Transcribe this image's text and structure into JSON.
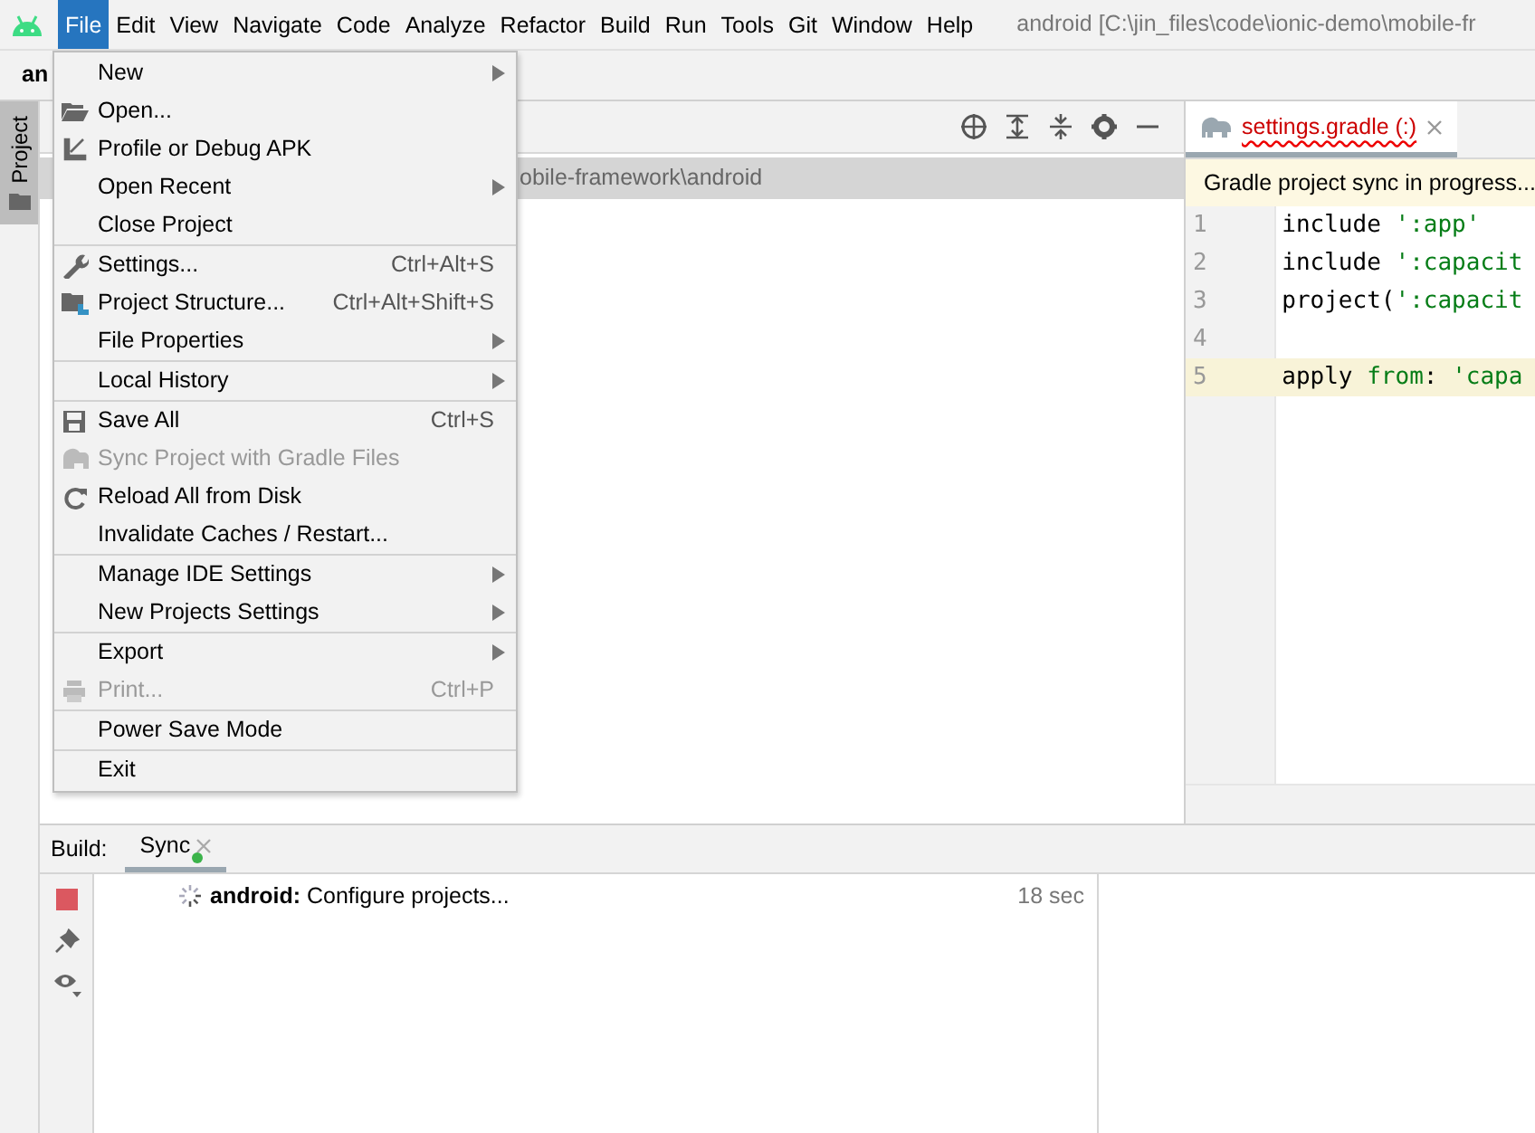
{
  "menu_bar": {
    "items": [
      {
        "label": "File",
        "selected": true
      },
      {
        "label": "Edit",
        "selected": false
      },
      {
        "label": "View",
        "selected": false
      },
      {
        "label": "Navigate",
        "selected": false
      },
      {
        "label": "Code",
        "selected": false
      },
      {
        "label": "Analyze",
        "selected": false
      },
      {
        "label": "Refactor",
        "selected": false
      },
      {
        "label": "Build",
        "selected": false
      },
      {
        "label": "Run",
        "selected": false
      },
      {
        "label": "Tools",
        "selected": false
      },
      {
        "label": "Git",
        "selected": false
      },
      {
        "label": "Window",
        "selected": false
      },
      {
        "label": "Help",
        "selected": false
      }
    ],
    "title": "android [C:\\jin_files\\code\\ionic-demo\\mobile-fr"
  },
  "navigation_bar": {
    "breadcrumb": "an"
  },
  "tool_window_stripe": {
    "tabs": [
      {
        "label": "Project",
        "selected": true
      }
    ]
  },
  "project_panel": {
    "path": "obile-framework\\android"
  },
  "file_menu": {
    "groups": [
      [
        {
          "label": "New",
          "submenu": true,
          "disabled": false
        },
        {
          "label": "Open...",
          "submenu": false,
          "disabled": false
        },
        {
          "label": "Profile or Debug APK",
          "submenu": false,
          "disabled": false
        },
        {
          "label": "Open Recent",
          "submenu": true,
          "disabled": false
        },
        {
          "label": "Close Project",
          "submenu": false,
          "disabled": false
        }
      ],
      [
        {
          "label": "Settings...",
          "shortcut": "Ctrl+Alt+S",
          "submenu": false,
          "disabled": false
        },
        {
          "label": "Project Structure...",
          "shortcut": "Ctrl+Alt+Shift+S",
          "submenu": false,
          "disabled": false
        },
        {
          "label": "File Properties",
          "submenu": true,
          "disabled": false
        }
      ],
      [
        {
          "label": "Local History",
          "submenu": true,
          "disabled": false
        }
      ],
      [
        {
          "label": "Save All",
          "shortcut": "Ctrl+S",
          "submenu": false,
          "disabled": false
        },
        {
          "label": "Sync Project with Gradle Files",
          "submenu": false,
          "disabled": true
        },
        {
          "label": "Reload All from Disk",
          "submenu": false,
          "disabled": false
        },
        {
          "label": "Invalidate Caches / Restart...",
          "submenu": false,
          "disabled": false
        }
      ],
      [
        {
          "label": "Manage IDE Settings",
          "submenu": true,
          "disabled": false
        },
        {
          "label": "New Projects Settings",
          "submenu": true,
          "disabled": false
        }
      ],
      [
        {
          "label": "Export",
          "submenu": true,
          "disabled": false
        },
        {
          "label": "Print...",
          "shortcut": "Ctrl+P",
          "submenu": false,
          "disabled": true
        }
      ],
      [
        {
          "label": "Power Save Mode",
          "submenu": false,
          "disabled": false
        }
      ],
      [
        {
          "label": "Exit",
          "submenu": false,
          "disabled": false
        }
      ]
    ]
  },
  "editor": {
    "tabs": [
      {
        "label": "settings.gradle (:)",
        "selected": true
      }
    ],
    "banner": "Gradle project sync in progress...",
    "lines": [
      {
        "number": "1",
        "current": false,
        "tokens": [
          {
            "text": "include ",
            "kind": "plain"
          },
          {
            "text": "':app'",
            "kind": "string"
          }
        ]
      },
      {
        "number": "2",
        "current": false,
        "tokens": [
          {
            "text": "include ",
            "kind": "plain"
          },
          {
            "text": "':capacit",
            "kind": "string"
          }
        ]
      },
      {
        "number": "3",
        "current": false,
        "tokens": [
          {
            "text": "project(",
            "kind": "plain"
          },
          {
            "text": "':capacit",
            "kind": "string"
          }
        ]
      },
      {
        "number": "4",
        "current": false
      },
      {
        "number": "5",
        "current": true,
        "tokens": [
          {
            "text": "apply ",
            "kind": "plain"
          },
          {
            "text": "from",
            "kind": "string"
          },
          {
            "text": ": ",
            "kind": "plain"
          },
          {
            "text": "'capa",
            "kind": "string"
          }
        ]
      }
    ]
  },
  "build_panel": {
    "label": "Build:",
    "tabs": [
      {
        "label": "Sync",
        "selected": true,
        "running": true
      }
    ],
    "tree": [
      {
        "text": "**android:** Configure projects...",
        "time": "18 sec"
      }
    ]
  }
}
